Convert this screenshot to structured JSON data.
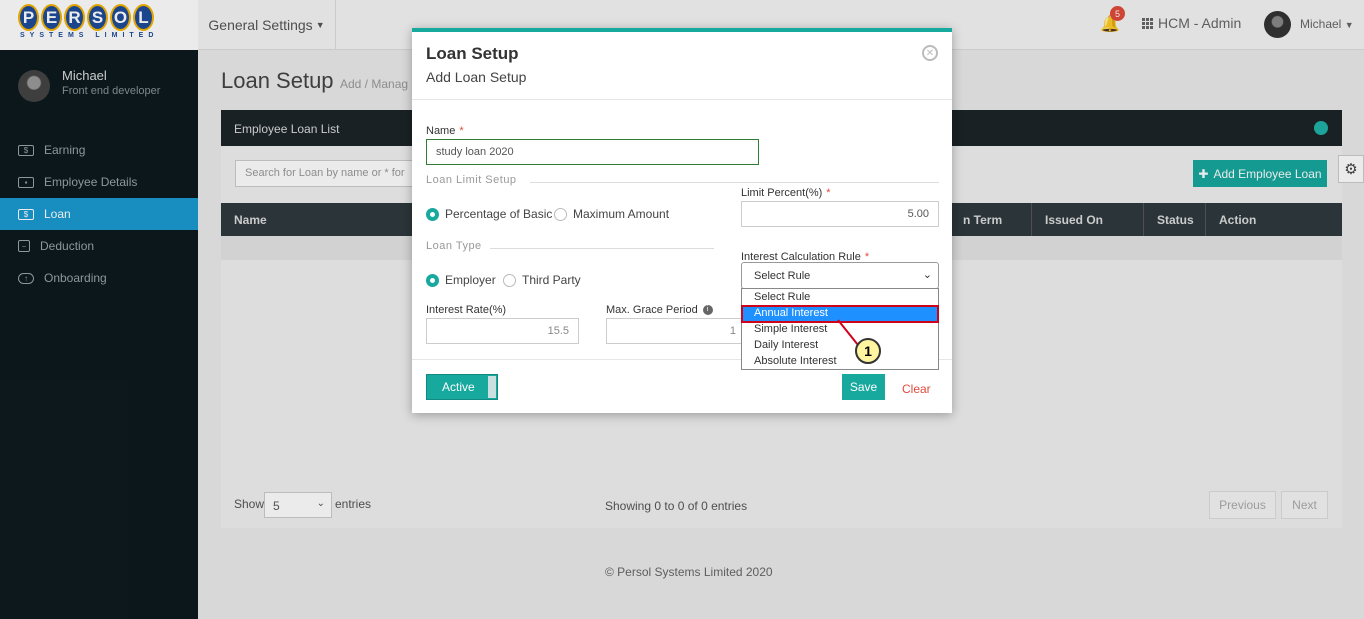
{
  "brand": {
    "logo_letters": [
      "P",
      "E",
      "R",
      "S",
      "O",
      "L"
    ],
    "logo_sub": "SYSTEMS LIMITED"
  },
  "topbar": {
    "menu": "General Settings",
    "notification_count": "5",
    "app_name": "HCM - Admin",
    "user": "Michael"
  },
  "sidebar": {
    "user_name": "Michael",
    "user_role": "Front end developer",
    "items": [
      {
        "label": "Earning",
        "icon": "money-icon"
      },
      {
        "label": "Employee Details",
        "icon": "id-card-icon"
      },
      {
        "label": "Loan",
        "icon": "money-icon"
      },
      {
        "label": "Deduction",
        "icon": "minus-square-icon"
      },
      {
        "label": "Onboarding",
        "icon": "cloud-upload-icon"
      }
    ],
    "active_item": "Loan"
  },
  "page": {
    "title": "Loan Setup",
    "subtitle": "Add / Manag",
    "panel_title": "Employee Loan List",
    "search_placeholder": "Search for Loan by name or * for",
    "add_button": "Add Employee Loan",
    "columns": [
      "Name",
      "n Term",
      "Issued On",
      "Status",
      "Action"
    ],
    "footer": {
      "show": "Show",
      "page_size": "5",
      "entries": "entries",
      "showing": "Showing 0 to 0 of 0 entries",
      "previous": "Previous",
      "next": "Next"
    },
    "copyright": "© Persol Systems Limited 2020"
  },
  "modal": {
    "title": "Loan Setup",
    "subtitle": "Add Loan Setup",
    "name_label": "Name",
    "name_value": "study loan 2020",
    "loan_limit_section": "Loan Limit Setup",
    "limit_options": [
      "Percentage of Basic",
      "Maximum Amount"
    ],
    "limit_selected": "Percentage of Basic",
    "limit_percent_label": "Limit Percent(%)",
    "limit_percent_value": "5.00",
    "loan_type_section": "Loan Type",
    "type_options": [
      "Employer",
      "Third Party"
    ],
    "type_selected": "Employer",
    "interest_rule_label": "Interest Calculation Rule",
    "interest_rule_value": "Select Rule",
    "interest_rate_label": "Interest Rate(%)",
    "interest_rate_value": "15.5",
    "grace_label": "Max. Grace Period",
    "grace_value": "1",
    "active_label": "Active",
    "save_label": "Save",
    "clear_label": "Clear"
  },
  "dropdown": {
    "options": [
      "Select Rule",
      "Annual Interest",
      "Simple Interest",
      "Daily Interest",
      "Absolute Interest"
    ],
    "highlighted": "Annual Interest"
  },
  "callout": {
    "number": "1"
  },
  "colors": {
    "accent": "#17a89e",
    "sidebar": "#0d1a1e",
    "active_nav": "#1b9bd1",
    "required": "#e04b3b",
    "highlight": "#1e90ff",
    "callout_border": "#d0021b"
  }
}
